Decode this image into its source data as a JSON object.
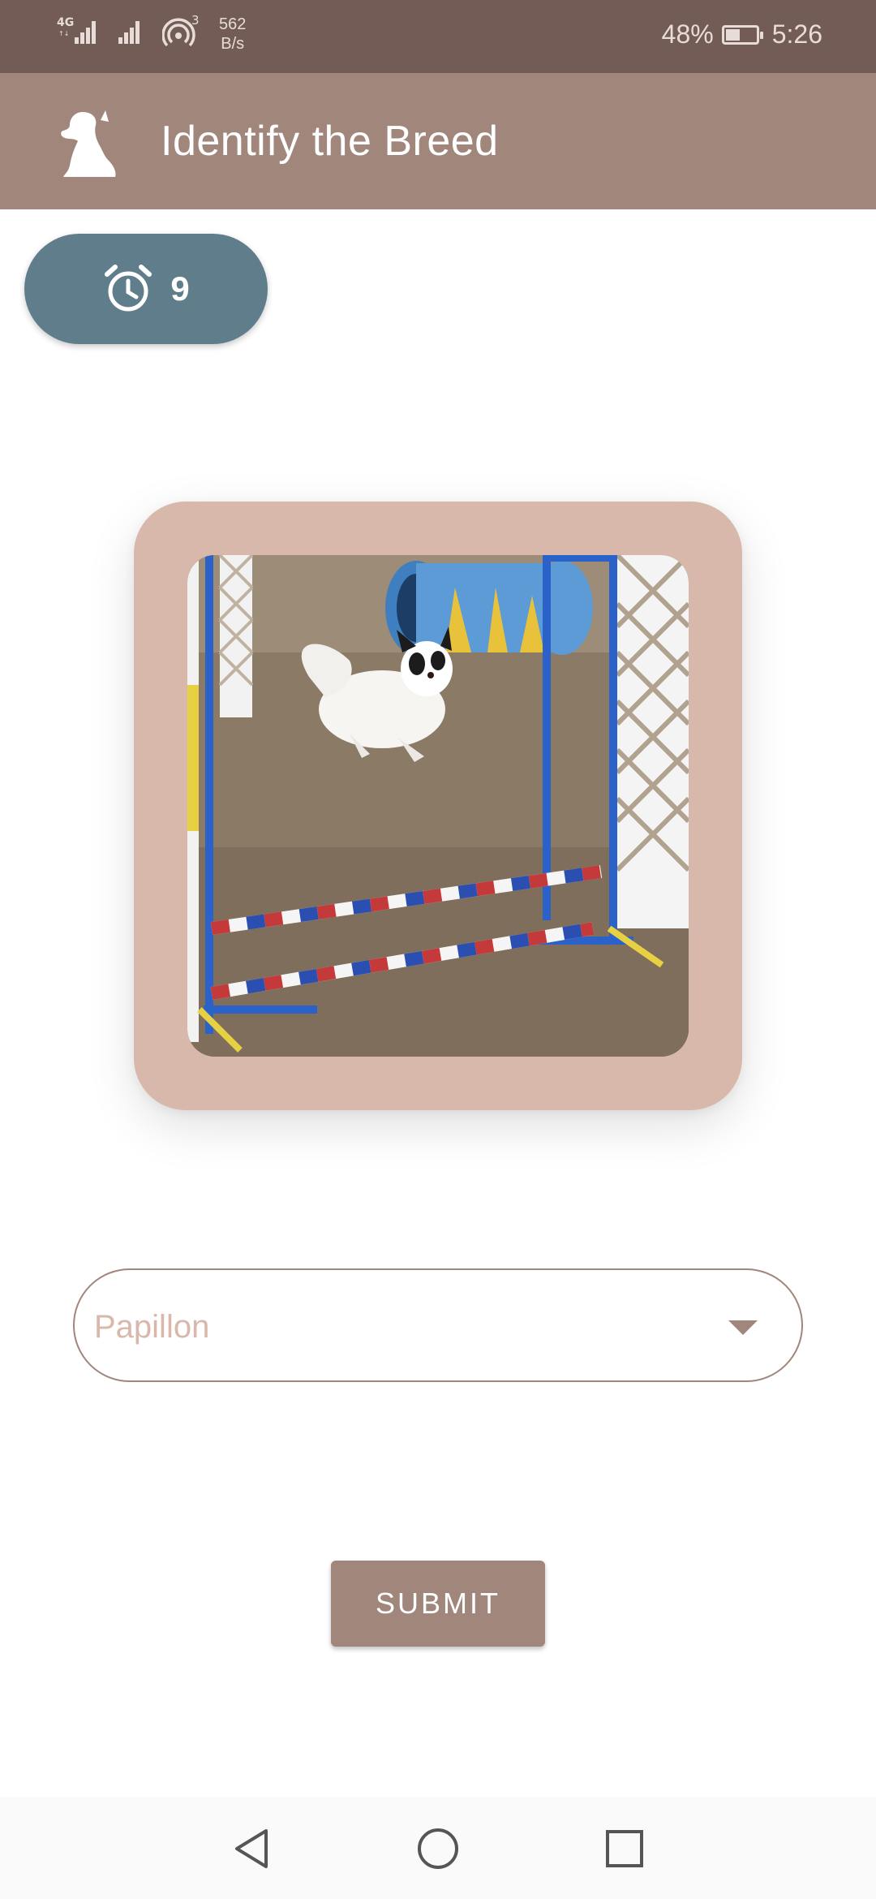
{
  "status_bar": {
    "network_type": "4G",
    "net_speed_value": "562",
    "net_speed_unit": "B/s",
    "hotspot_count": "3",
    "battery_percent": "48%",
    "battery_level": 0.48,
    "time": "5:26",
    "icons": [
      "signal-4g-icon",
      "signal-icon",
      "hotspot-icon",
      "battery-icon"
    ]
  },
  "app_bar": {
    "title": "Identify the Breed",
    "logo_icon": "dog-logo-icon",
    "background": "#a1867c"
  },
  "timer": {
    "icon": "alarm-clock-icon",
    "value": "9",
    "background": "#607d8b"
  },
  "image_card": {
    "background": "#d7b8ab",
    "photo_subject": "dog-agility-jump-photo"
  },
  "breed_select": {
    "selected": "Papillon",
    "text_color": "#d7b8ab",
    "border_color": "#a1867c",
    "arrow_icon": "dropdown-arrow-icon"
  },
  "submit": {
    "label": "SUBMIT",
    "background": "#a1867c"
  },
  "nav_bar": {
    "icons": [
      "back-icon",
      "home-icon",
      "recents-icon"
    ]
  },
  "colors": {
    "status_bar": "#735c55",
    "accent": "#a1867c"
  }
}
